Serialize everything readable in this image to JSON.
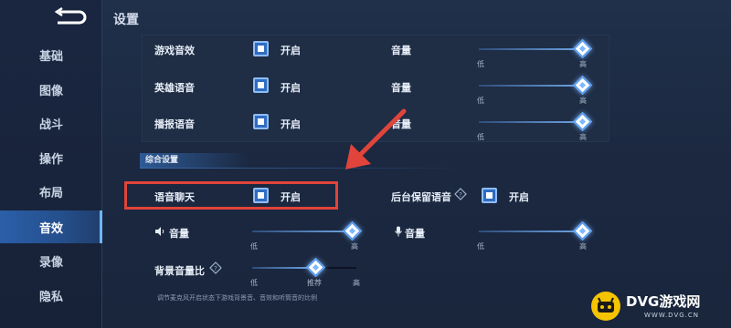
{
  "header": {
    "title": "设置"
  },
  "sidebar": {
    "items": [
      {
        "label": "基础"
      },
      {
        "label": "图像"
      },
      {
        "label": "战斗"
      },
      {
        "label": "操作"
      },
      {
        "label": "布局"
      },
      {
        "label": "音效",
        "active": true
      },
      {
        "label": "录像"
      },
      {
        "label": "隐私"
      }
    ]
  },
  "sound_rows": [
    {
      "label": "游戏音效",
      "toggle": "开启",
      "volume_label": "音量",
      "volume": 1.0,
      "low": "低",
      "high": "高"
    },
    {
      "label": "英雄语音",
      "toggle": "开启",
      "volume_label": "音量",
      "volume": 1.0,
      "low": "低",
      "high": "高"
    },
    {
      "label": "播报语音",
      "toggle": "开启",
      "volume_label": "音量",
      "volume": 1.0,
      "low": "低",
      "high": "高"
    }
  ],
  "general": {
    "section_title": "综合设置",
    "voice_chat": {
      "label": "语音聊天",
      "toggle": "开启"
    },
    "background_voice": {
      "label": "后台保留语音",
      "toggle": "开启"
    },
    "speaker_volume": {
      "label": "音量",
      "volume": 1.0,
      "low": "低",
      "high": "高"
    },
    "mic_volume": {
      "label": "音量",
      "volume": 1.0,
      "low": "低",
      "high": "高"
    },
    "bg_ratio": {
      "label": "背景音量比",
      "value": 0.5,
      "low": "低",
      "mid": "推荐",
      "high": "高"
    },
    "hint": "调节麦克风开启状态下游戏背景音、音效和听筒音的比例"
  },
  "icons": {
    "back": "back-arrow-icon",
    "speaker": "speaker-icon",
    "mic": "microphone-icon",
    "help": "help-diamond-icon",
    "arrow": "red-arrow-annotation"
  },
  "colors": {
    "accent": "#2f6cc2",
    "highlight_box": "#e0443b",
    "active_tab": "#2a5fa8",
    "watermark_yellow": "#f5c400"
  },
  "watermark": {
    "title": "DVG游戏网",
    "subtitle": "WWW.DVG.CN"
  }
}
